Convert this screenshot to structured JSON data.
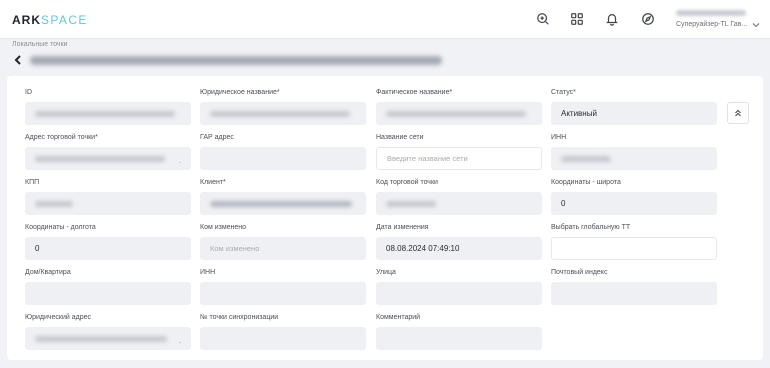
{
  "app": {
    "logo_ark": "ARK",
    "logo_space": "SPACE"
  },
  "topbar": {
    "icons": [
      "support-icon",
      "apps-grid-icon",
      "bell-icon",
      "compass-icon"
    ],
    "user_role": "Суперуайзер-TL Гав..."
  },
  "breadcrumb": "Локальные точки",
  "form": {
    "fields": [
      {
        "key": "id",
        "label": "ID",
        "value": "",
        "blurred": true
      },
      {
        "key": "legal_name",
        "label": "Юридическое название*",
        "value": "",
        "blurred": true
      },
      {
        "key": "actual_name",
        "label": "Фактическое название*",
        "value": "",
        "blurred": true
      },
      {
        "key": "status",
        "label": "Статус*",
        "value": "Активный"
      },
      {
        "key": "address",
        "label": "Адрес торговой точки*",
        "value": "",
        "blurred": true
      },
      {
        "key": "gar_address",
        "label": "ГАР адрес",
        "value": ""
      },
      {
        "key": "network_name",
        "label": "Название сети",
        "placeholder": "Введите название сети"
      },
      {
        "key": "inn",
        "label": "ИНН",
        "value": "",
        "blurred": true
      },
      {
        "key": "kpp",
        "label": "КПП",
        "value": "",
        "blurred": true
      },
      {
        "key": "client",
        "label": "Клиент*",
        "value": "",
        "blurred": true
      },
      {
        "key": "outlet_code",
        "label": "Код торговой точки",
        "value": "",
        "blurred": true
      },
      {
        "key": "latitude",
        "label": "Координаты - широта",
        "value": "0"
      },
      {
        "key": "longitude",
        "label": "Координаты - долгота",
        "value": "0"
      },
      {
        "key": "changed_by",
        "label": "Ком изменено",
        "placeholder": "Ком изменено"
      },
      {
        "key": "changed_date",
        "label": "Дата изменения",
        "value": "08.08.2024 07:49:10"
      },
      {
        "key": "global_tt",
        "label": "Выбрать глобальную ТТ",
        "value": ""
      },
      {
        "key": "house",
        "label": "Дом/Квартира",
        "value": ""
      },
      {
        "key": "inn2",
        "label": "ИНН",
        "value": ""
      },
      {
        "key": "street",
        "label": "Улица",
        "value": ""
      },
      {
        "key": "postal_code",
        "label": "Почтовый индекс",
        "value": ""
      },
      {
        "key": "legal_address",
        "label": "Юридический адрес",
        "value": "",
        "blurred": true
      },
      {
        "key": "sync_number",
        "label": "№ точки синхронизации",
        "value": ""
      },
      {
        "key": "comment",
        "label": "Комментарий",
        "value": ""
      }
    ]
  }
}
